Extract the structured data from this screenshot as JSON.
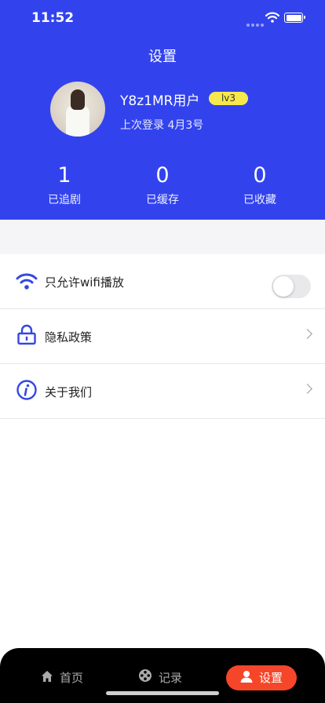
{
  "status_bar": {
    "time": "11:52"
  },
  "header": {
    "title": "设置"
  },
  "profile": {
    "username": "Y8z1MR用户",
    "level": "lv3",
    "last_login": "上次登录 4月3号"
  },
  "stats": [
    {
      "value": "1",
      "label": "已追剧"
    },
    {
      "value": "0",
      "label": "已缓存"
    },
    {
      "value": "0",
      "label": "已收藏"
    }
  ],
  "menu": {
    "wifi_only": {
      "label": "只允许wifi播放",
      "icon": "wifi-icon",
      "enabled": false
    },
    "privacy": {
      "label": "隐私政策",
      "icon": "lock-icon"
    },
    "about": {
      "label": "关于我们",
      "icon": "info-icon"
    }
  },
  "tabbar": {
    "items": [
      {
        "label": "首页",
        "icon": "home-icon"
      },
      {
        "label": "记录",
        "icon": "film-reel-icon"
      },
      {
        "label": "设置",
        "icon": "person-icon"
      }
    ],
    "active": "设置"
  },
  "colors": {
    "primary": "#3243ee",
    "accent": "#f5462a",
    "badge": "#f8e94a",
    "icon": "#3448e0"
  }
}
